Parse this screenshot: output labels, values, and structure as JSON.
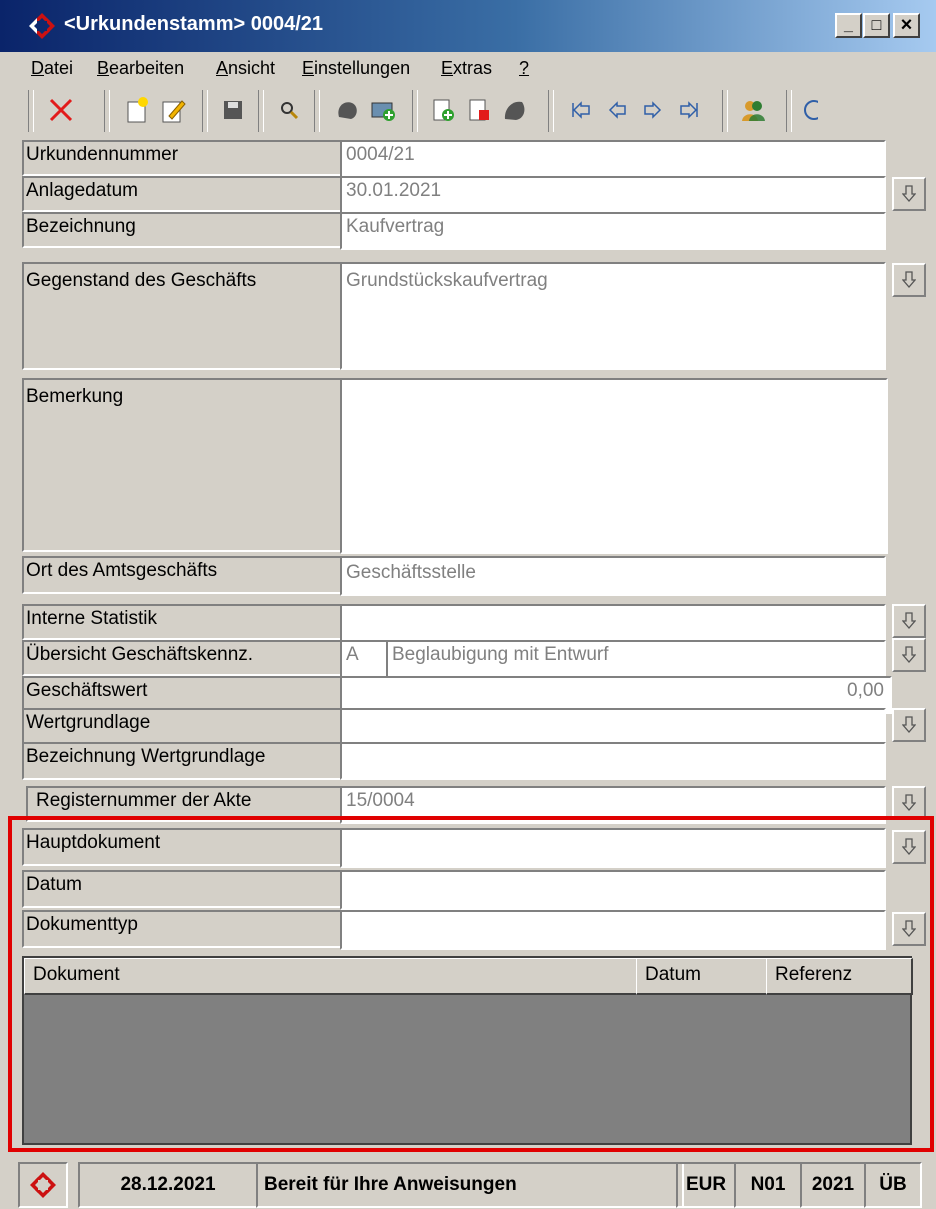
{
  "window": {
    "title": "<Urkundenstamm> 0004/21",
    "minimize": "_",
    "maximize": "□",
    "close": "×"
  },
  "menu": [
    "Datei",
    "Bearbeiten",
    "Ansicht",
    "Einstellungen",
    "Extras",
    "?"
  ],
  "menu_underline": [
    "D",
    "B",
    "A",
    "E",
    "E",
    "?"
  ],
  "toolbar_icons": [
    "delete-icon",
    "new-doc-icon",
    "edit-doc-icon",
    "save-icon",
    "search-icon",
    "blob-icon",
    "add-envelope-icon",
    "add-record-icon",
    "delete-record-icon",
    "blob2-icon",
    "first-icon",
    "prev-icon",
    "next-icon",
    "last-icon",
    "users-icon",
    "more-icon"
  ],
  "form": {
    "urkundennummer": {
      "label": "Urkundennummer",
      "value": "0004/21"
    },
    "anlagedatum": {
      "label": "Anlagedatum",
      "value": "30.01.2021"
    },
    "bezeichnung": {
      "label": "Bezeichnung",
      "value": "Kaufvertrag"
    },
    "gegenstand": {
      "label": "Gegenstand des Geschäfts",
      "value": "Grundstückskaufvertrag"
    },
    "bemerkung": {
      "label": "Bemerkung",
      "value": ""
    },
    "ort": {
      "label": "Ort des Amtsgeschäfts",
      "value": "Geschäftsstelle"
    },
    "interne_statistik": {
      "label": "Interne Statistik",
      "value": ""
    },
    "uebersicht": {
      "label": "Übersicht Geschäftskennz.",
      "code": "A",
      "value": "Beglaubigung mit Entwurf"
    },
    "geschaeftswert": {
      "label": "Geschäftswert",
      "value": "0,00"
    },
    "wertgrundlage": {
      "label": "Wertgrundlage",
      "value": ""
    },
    "bez_wertgrundlage": {
      "label": "Bezeichnung Wertgrundlage",
      "value": ""
    },
    "registernummer": {
      "label": "Registernummer der Akte",
      "value": "15/0004"
    },
    "hauptdokument": {
      "label": "Hauptdokument",
      "value": ""
    },
    "datum": {
      "label": "Datum",
      "value": ""
    },
    "dokumenttyp": {
      "label": "Dokumenttyp",
      "value": ""
    }
  },
  "grid": {
    "columns": [
      "Dokument",
      "Datum",
      "Referenz"
    ],
    "rows": []
  },
  "status": {
    "date": "28.12.2021",
    "message": "Bereit für Ihre Anweisungen",
    "currency": "EUR",
    "code": "N01",
    "year": "2021",
    "mode": "ÜB"
  },
  "colors": {
    "title_start": "#0a246a",
    "title_end": "#a6caf0",
    "highlight": "#e00000",
    "logo_red": "#cc1111"
  }
}
